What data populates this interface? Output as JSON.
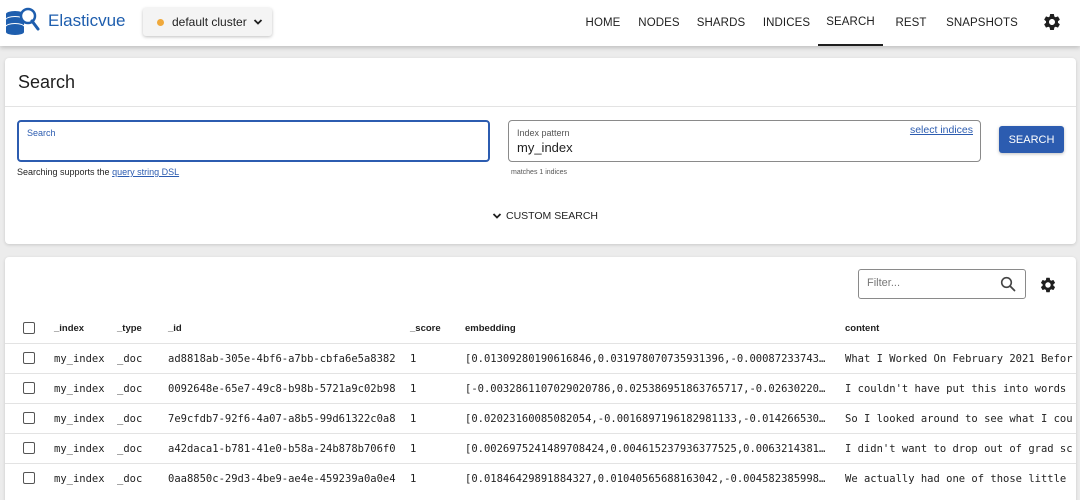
{
  "app": {
    "title": "Elasticvue",
    "cluster_label": "default cluster",
    "cluster_color": "#f0a93b"
  },
  "nav": [
    "HOME",
    "NODES",
    "SHARDS",
    "INDICES",
    "SEARCH",
    "REST",
    "SNAPSHOTS"
  ],
  "nav_active": "SEARCH",
  "search": {
    "title": "Search",
    "search_label": "Search",
    "hint_prefix": "Searching supports the ",
    "hint_link": "query string DSL",
    "index_label": "Index pattern",
    "index_value": "my_index",
    "select_indices": "select indices",
    "matches": "matches 1 indices",
    "button": "SEARCH",
    "custom_search": "CUSTOM SEARCH"
  },
  "results": {
    "filter_placeholder": "Filter...",
    "headers": [
      "_index",
      "_type",
      "_id",
      "_score",
      "embedding",
      "content"
    ],
    "rows": [
      {
        "index": "my_index",
        "type": "_doc",
        "id": "ad8818ab-305e-4bf6-a7bb-cbfa6e5a8382",
        "score": "1",
        "embedding": "[0.01309280190616846,0.031978070735931396,-0.00087233743…",
        "content": "What I Worked On February 2021 Befor"
      },
      {
        "index": "my_index",
        "type": "_doc",
        "id": "0092648e-65e7-49c8-b98b-5721a9c02b98",
        "score": "1",
        "embedding": "[-0.0032861107029020786,0.025386951863765717,-0.02630220…",
        "content": "I couldn't have put this into words"
      },
      {
        "index": "my_index",
        "type": "_doc",
        "id": "7e9cfdb7-92f6-4a07-a8b5-99d61322c0a8",
        "score": "1",
        "embedding": "[0.02023160085082054,-0.0016897196182981133,-0.014266530…",
        "content": "So I looked around to see what I cou"
      },
      {
        "index": "my_index",
        "type": "_doc",
        "id": "a42daca1-b781-41e0-b58a-24b878b706f0",
        "score": "1",
        "embedding": "[0.0026975241489708424,0.004615237936377525,0.0063214381…",
        "content": "I didn't want to drop out of grad sc"
      },
      {
        "index": "my_index",
        "type": "_doc",
        "id": "0aa8850c-29d3-4be9-ae4e-459239a0a0e4",
        "score": "1",
        "embedding": "[0.01846429891884327,0.01040565688163042,-0.004582385998…",
        "content": "We actually had one of those little"
      }
    ]
  }
}
